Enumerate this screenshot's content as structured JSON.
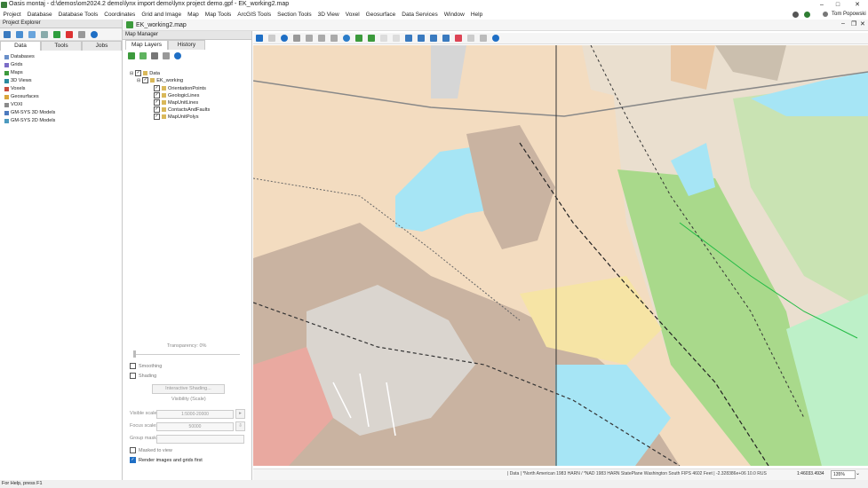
{
  "app": {
    "title": "Oasis montaj - d:\\demos\\om2024.2 demo\\lynx import demo\\lynx project demo.gpf - EK_working2.map",
    "user": "Tom Popowski"
  },
  "menu": [
    "Project",
    "Database",
    "Database Tools",
    "Coordinates",
    "Grid and Image",
    "Map",
    "Map Tools",
    "ArcGIS Tools",
    "Section Tools",
    "3D View",
    "Voxel",
    "Geosurface",
    "Data Services",
    "Window",
    "Help"
  ],
  "project_explorer": {
    "title": "Project Explorer",
    "tabs": [
      "Data",
      "Tools",
      "Jobs"
    ],
    "items": [
      "Databases",
      "Grids",
      "Maps",
      "3D Views",
      "Voxels",
      "Geosurfaces",
      "VOXI",
      "GM-SYS 3D Models",
      "GM-SYS 2D Models"
    ]
  },
  "map_window": {
    "title": "EK_working2.map"
  },
  "map_manager": {
    "title": "Map Manager",
    "tabs": [
      "Map Layers",
      "History"
    ],
    "root": "Data",
    "group": "EK_working",
    "layers": [
      "OrientationPoints",
      "GeologicLines",
      "MapUnitLines",
      "ContactsAndFaults",
      "MapUnitPolys"
    ],
    "transparency_label": "Transparency: 0%",
    "smoothing": "Smoothing",
    "shading": "Shading",
    "interactive_shading": "Interactive Shading...",
    "visibility_header": "Visibility (Scale)",
    "visible_scales_label": "Visible scales:",
    "visible_scales_value": "1:5000-20000",
    "focus_scales_label": "Focus scales:",
    "focus_scales_value": "50000",
    "group_mask_label": "Group mask:",
    "masked_to_view": "Masked to view",
    "render_first": "Render images and grids first"
  },
  "status": {
    "help": "For Help, press F1",
    "coords": "| Data | *North American 1983 HARN / *NAD 1983 HARN StatePlane Washington South FIPS 4602 Feet | -2.328386e+06 10.0 RUS",
    "scale": "1:46033.4934",
    "zoom": "135%"
  },
  "colors": {
    "accent": "#1f6fc5",
    "map_tan": "#f3dcc0",
    "map_water": "#a6e5f5",
    "map_grey": "#c9b3a1",
    "map_green": "#a9d98b"
  }
}
